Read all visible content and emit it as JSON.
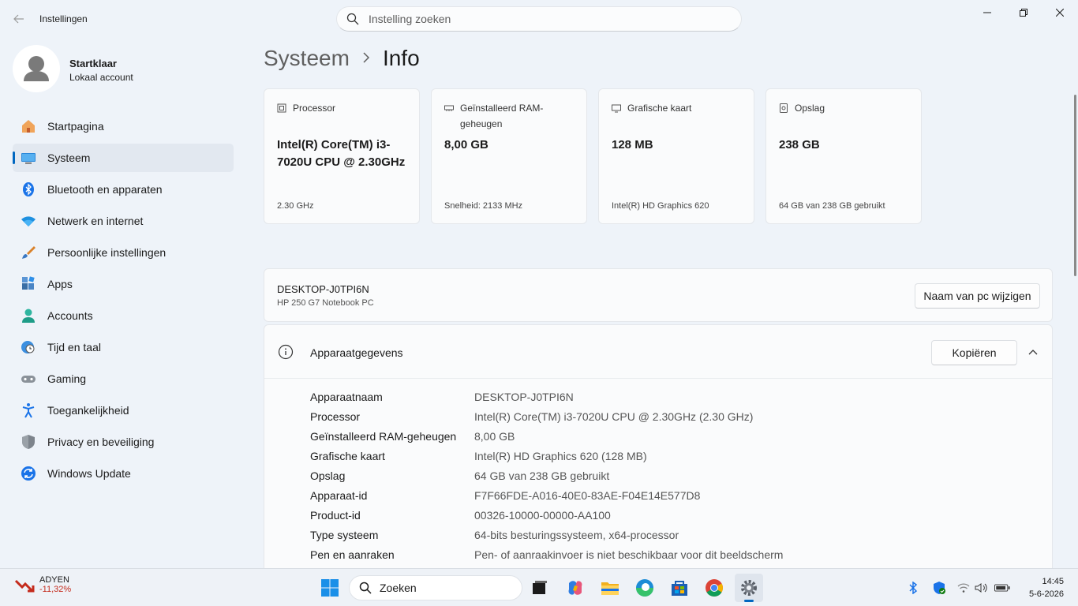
{
  "window": {
    "title": "Instellingen",
    "search_placeholder": "Instelling zoeken"
  },
  "profile": {
    "name": "Startklaar",
    "account_type": "Lokaal account"
  },
  "sidebar": {
    "items": [
      {
        "label": "Startpagina",
        "icon": "home-icon"
      },
      {
        "label": "Systeem",
        "icon": "system-icon",
        "active": true
      },
      {
        "label": "Bluetooth en apparaten",
        "icon": "bluetooth-icon"
      },
      {
        "label": "Netwerk en internet",
        "icon": "wifi-icon"
      },
      {
        "label": "Persoonlijke instellingen",
        "icon": "brush-icon"
      },
      {
        "label": "Apps",
        "icon": "apps-icon"
      },
      {
        "label": "Accounts",
        "icon": "accounts-icon"
      },
      {
        "label": "Tijd en taal",
        "icon": "globe-clock-icon"
      },
      {
        "label": "Gaming",
        "icon": "gamepad-icon"
      },
      {
        "label": "Toegankelijkheid",
        "icon": "accessibility-icon"
      },
      {
        "label": "Privacy en beveiliging",
        "icon": "shield-icon"
      },
      {
        "label": "Windows Update",
        "icon": "update-icon"
      }
    ]
  },
  "breadcrumb": {
    "parent": "Systeem",
    "current": "Info"
  },
  "spec_cards": [
    {
      "title": "Processor",
      "value": "Intel(R) Core(TM) i3-7020U CPU @ 2.30GHz",
      "sub": "2.30 GHz",
      "icon": "cpu-icon"
    },
    {
      "title": "Geïnstalleerd RAM-geheugen",
      "value": "8,00 GB",
      "sub": "Snelheid: 2133 MHz",
      "icon": "ram-icon"
    },
    {
      "title": "Grafische kaart",
      "value": "128 MB",
      "sub": "Intel(R) HD Graphics 620",
      "icon": "gpu-icon"
    },
    {
      "title": "Opslag",
      "value": "238 GB",
      "sub": "64 GB van 238 GB gebruikt",
      "icon": "storage-icon"
    }
  ],
  "device": {
    "name": "DESKTOP-J0TPI6N",
    "model": "HP 250 G7 Notebook PC",
    "rename_button": "Naam van pc wijzigen"
  },
  "specs_section": {
    "title": "Apparaatgegevens",
    "copy_button": "Kopiëren",
    "rows": [
      {
        "key": "Apparaatnaam",
        "value": "DESKTOP-J0TPI6N"
      },
      {
        "key": "Processor",
        "value": "Intel(R) Core(TM) i3-7020U CPU @ 2.30GHz (2.30 GHz)"
      },
      {
        "key": "Geïnstalleerd RAM-geheugen",
        "value": "8,00 GB"
      },
      {
        "key": "Grafische kaart",
        "value": "Intel(R) HD Graphics 620 (128 MB)"
      },
      {
        "key": "Opslag",
        "value": "64 GB van 238 GB gebruikt"
      },
      {
        "key": "Apparaat-id",
        "value": "F7F66FDE-A016-40E0-83AE-F04E14E577D8"
      },
      {
        "key": "Product-id",
        "value": "00326-10000-00000-AA100"
      },
      {
        "key": "Type systeem",
        "value": "64-bits besturingssysteem, x64-processor"
      },
      {
        "key": "Pen en aanraken",
        "value": "Pen- of aanraakinvoer is niet beschikbaar voor dit beeldscherm"
      }
    ]
  },
  "taskbar": {
    "stock_name": "ADYEN",
    "stock_change": "-11,32%",
    "search_placeholder": "Zoeken",
    "time": "14:45",
    "date": "5-6-2026"
  },
  "colors": {
    "accent": "#0067c0",
    "background": "#eef3f9",
    "stock_negative": "#c42b1c"
  }
}
